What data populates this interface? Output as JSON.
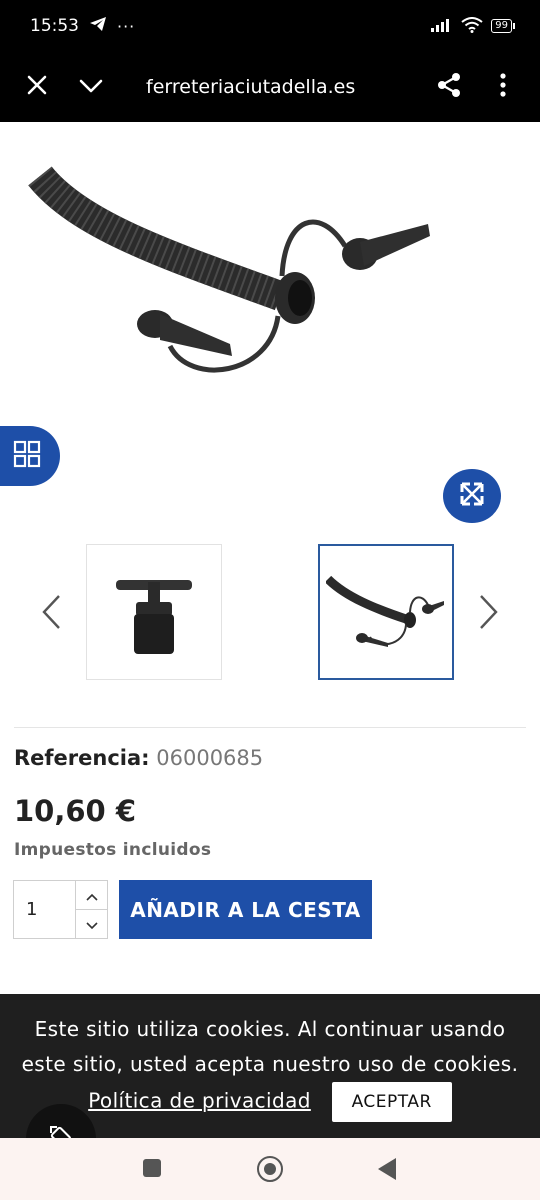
{
  "status_bar": {
    "time": "15:53",
    "notification_icons": [
      "telegram-icon",
      "more-notifications-icon"
    ],
    "battery": "99",
    "extra_icons": [
      "signal-icon",
      "wifi-icon",
      "battery-icon"
    ]
  },
  "browser": {
    "url": "ferreteriaciutadella.es",
    "icons": [
      "close-icon",
      "chevron-down-icon",
      "share-icon",
      "overflow-menu-icon"
    ]
  },
  "gallery": {
    "main_image": "black-inflator-hose-with-nozzles",
    "thumbnails": [
      {
        "subject": "hand-pump-top",
        "selected": false
      },
      {
        "subject": "inflator-hose-with-nozzles",
        "selected": true
      }
    ]
  },
  "product": {
    "reference_label": "Referencia:",
    "reference_value": "06000685",
    "price": "10,60 €",
    "tax_note": "Impuestos incluidos",
    "quantity": "1",
    "add_to_cart_label": "AÑADIR A LA CESTA"
  },
  "cookie": {
    "message": "Este sitio utiliza cookies. Al continuar usando este sitio, usted acepta nuestro uso de cookies.",
    "link_label": "Política de privacidad",
    "accept_label": "ACEPTAR"
  },
  "colors": {
    "brand_blue": "#1e4fa8",
    "selected_border": "#2a5a9e",
    "cookie_bg": "#1f1f1f",
    "top_bar_bg": "#000000",
    "nav_bar_bg": "#fcf3f1"
  }
}
